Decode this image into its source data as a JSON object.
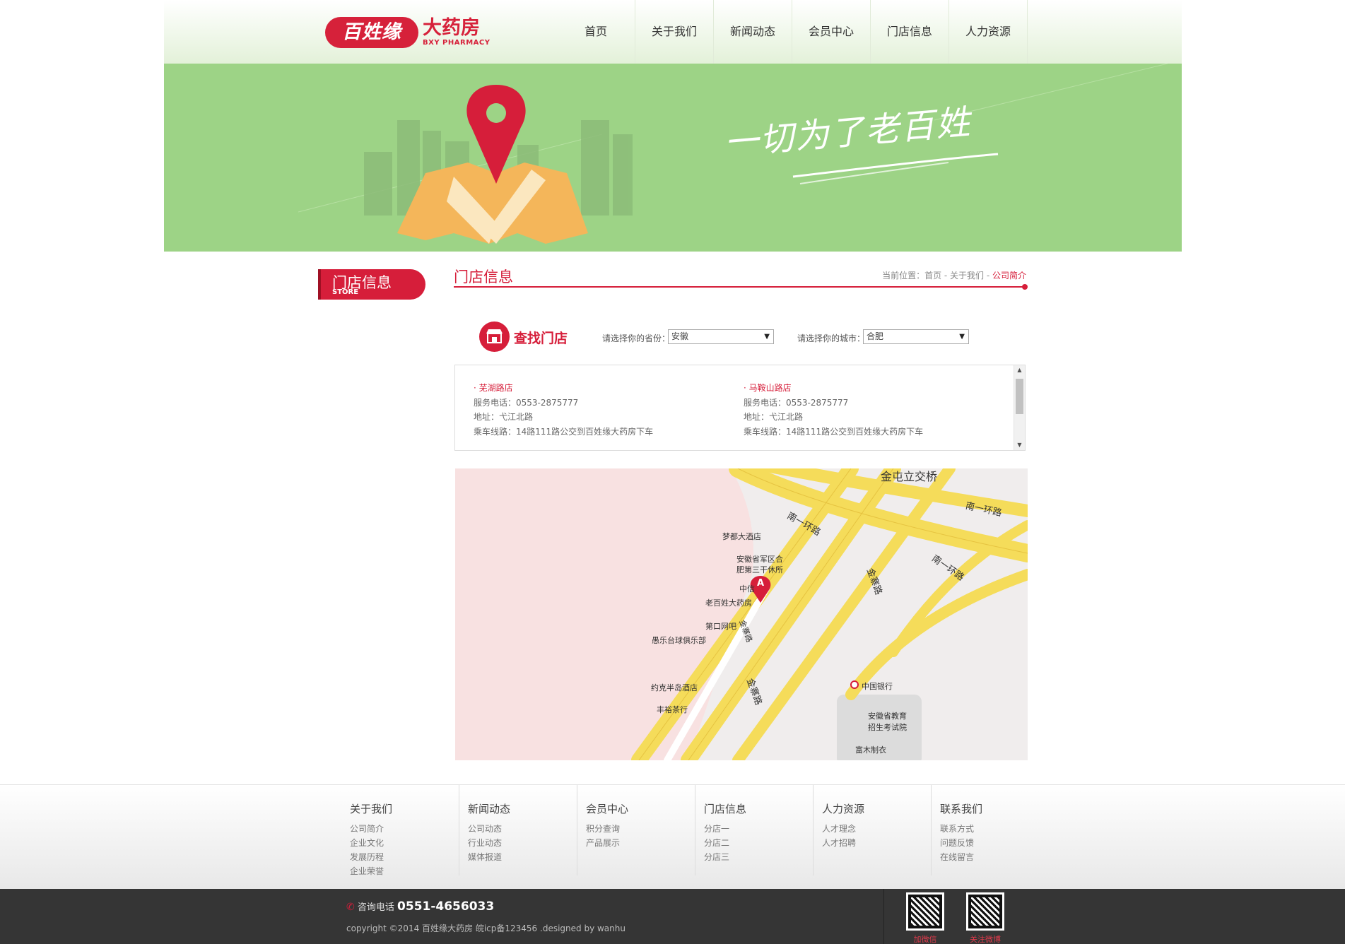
{
  "header": {
    "logo_badge": "百姓缘",
    "logo_cn": "大药房",
    "logo_en": "BXY PHARMACY",
    "nav": [
      "首页",
      "关于我们",
      "新闻动态",
      "会员中心",
      "门店信息",
      "人力资源"
    ]
  },
  "banner": {
    "slogan": "一切为了老百姓"
  },
  "sidebar": {
    "title_cn": "门店信息",
    "title_en": "STORE"
  },
  "main": {
    "title": "门店信息",
    "breadcrumb": {
      "prefix": "当前位置：首页 - 关于我们 - ",
      "current": "公司简介"
    }
  },
  "finder": {
    "title": "查找门店",
    "province_label": "请选择你的省份：",
    "province_value": "安徽",
    "city_label": "请选择你的城市：",
    "city_value": "合肥"
  },
  "stores": [
    {
      "name": "· 芜湖路店",
      "phone": "服务电话：0553-2875777",
      "address": "地址：弋江北路",
      "route": "乘车线路：14路111路公交到百姓缘大药房下车"
    },
    {
      "name": "· 马鞍山路店",
      "phone": "服务电话：0553-2875777",
      "address": "地址：弋江北路",
      "route": "乘车线路：14路111路公交到百姓缘大药房下车"
    }
  ],
  "map": {
    "marker": "A",
    "roads": [
      "金屯立交桥",
      "南一环路",
      "南一环路",
      "南一环路",
      "金寨路",
      "金寨路",
      "金寨路"
    ],
    "pois": [
      "梦都大酒店",
      "安徽省军区合",
      "肥第三干休所",
      "中信",
      "老百姓大药房",
      "第口网吧",
      "愚乐台球俱乐部",
      "约克半岛酒店",
      "丰裕茶行",
      "中国银行",
      "安徽省教育",
      "招生考试院",
      "富木制衣"
    ]
  },
  "footer": {
    "columns": [
      {
        "title": "关于我们",
        "links": [
          "公司简介",
          "企业文化",
          "发展历程",
          "企业荣誉"
        ]
      },
      {
        "title": "新闻动态",
        "links": [
          "公司动态",
          "行业动态",
          "媒体报道"
        ]
      },
      {
        "title": "会员中心",
        "links": [
          "积分查询",
          "产品展示"
        ]
      },
      {
        "title": "门店信息",
        "links": [
          "分店一",
          "分店二",
          "分店三"
        ]
      },
      {
        "title": "人力资源",
        "links": [
          "人才理念",
          "人才招聘"
        ]
      },
      {
        "title": "联系我们",
        "links": [
          "联系方式",
          "问题反馈",
          "在线留言"
        ]
      }
    ],
    "hotline_label": "咨询电话",
    "hotline_number": "0551-4656033",
    "copyright": "copyright ©2014 百姓缘大药房 皖icp备123456 .designed by wanhu",
    "qr_labels": [
      "加微信",
      "关注微博"
    ]
  }
}
